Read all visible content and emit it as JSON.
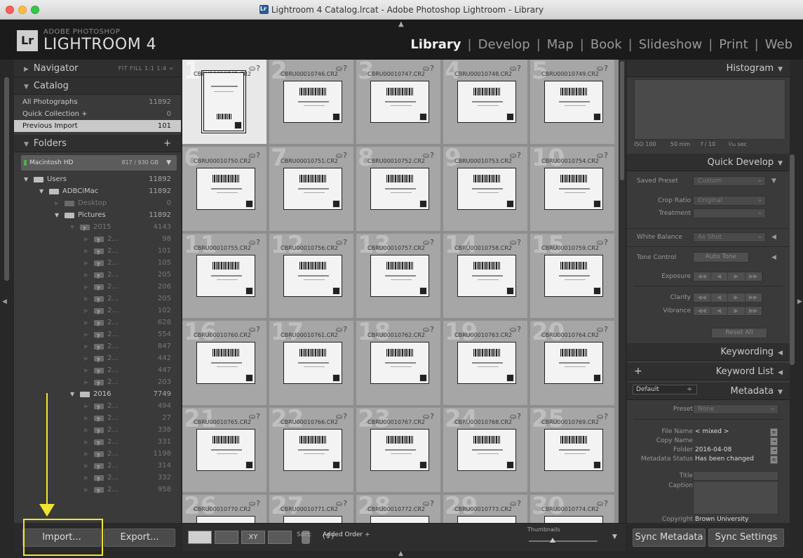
{
  "window": {
    "title": "Lightroom 4 Catalog.lrcat - Adobe Photoshop Lightroom - Library"
  },
  "brand": {
    "logo": "Lr",
    "line1": "ADOBE PHOTOSHOP",
    "line2": "LIGHTROOM 4"
  },
  "modules": [
    "Library",
    "Develop",
    "Map",
    "Book",
    "Slideshow",
    "Print",
    "Web"
  ],
  "navigator": {
    "title": "Navigator",
    "options": "FIT  FILL  1:1  1:4 ÷"
  },
  "catalog": {
    "title": "Catalog",
    "items": [
      {
        "label": "All Photographs",
        "count": "11892"
      },
      {
        "label": "Quick Collection +",
        "count": "0"
      },
      {
        "label": "Previous Import",
        "count": "101"
      }
    ]
  },
  "folders": {
    "title": "Folders",
    "plus": "+",
    "volume": {
      "name": "Macintosh HD",
      "capacity": "817 / 930 GB",
      "menu": "▼"
    },
    "tree": [
      {
        "label": "Users",
        "count": "11892",
        "indent": 0,
        "open": true,
        "type": "folder",
        "dim": false
      },
      {
        "label": "ADBCiMac",
        "count": "11892",
        "indent": 1,
        "open": true,
        "type": "folder",
        "dim": false
      },
      {
        "label": "Desktop",
        "count": "0",
        "indent": 2,
        "open": false,
        "type": "folder",
        "dim": true
      },
      {
        "label": "Pictures",
        "count": "11892",
        "indent": 2,
        "open": true,
        "type": "folder",
        "dim": false
      },
      {
        "label": "2015",
        "count": "4143",
        "indent": 3,
        "open": true,
        "type": "q",
        "dim": true
      },
      {
        "label": "2...",
        "count": "98",
        "indent": 4,
        "open": false,
        "type": "q",
        "dim": true
      },
      {
        "label": "2...",
        "count": "101",
        "indent": 4,
        "open": false,
        "type": "q",
        "dim": true
      },
      {
        "label": "2...",
        "count": "105",
        "indent": 4,
        "open": false,
        "type": "q",
        "dim": true
      },
      {
        "label": "2...",
        "count": "205",
        "indent": 4,
        "open": false,
        "type": "q",
        "dim": true
      },
      {
        "label": "2...",
        "count": "206",
        "indent": 4,
        "open": false,
        "type": "q",
        "dim": true
      },
      {
        "label": "2...",
        "count": "205",
        "indent": 4,
        "open": false,
        "type": "q",
        "dim": true
      },
      {
        "label": "2...",
        "count": "102",
        "indent": 4,
        "open": false,
        "type": "q",
        "dim": true
      },
      {
        "label": "2...",
        "count": "628",
        "indent": 4,
        "open": false,
        "type": "q",
        "dim": true
      },
      {
        "label": "2...",
        "count": "554",
        "indent": 4,
        "open": false,
        "type": "q",
        "dim": true
      },
      {
        "label": "2...",
        "count": "847",
        "indent": 4,
        "open": false,
        "type": "q",
        "dim": true
      },
      {
        "label": "2...",
        "count": "442",
        "indent": 4,
        "open": false,
        "type": "q",
        "dim": true
      },
      {
        "label": "2...",
        "count": "447",
        "indent": 4,
        "open": false,
        "type": "q",
        "dim": true
      },
      {
        "label": "2...",
        "count": "203",
        "indent": 4,
        "open": false,
        "type": "q",
        "dim": true
      },
      {
        "label": "2016",
        "count": "7749",
        "indent": 3,
        "open": true,
        "type": "folder",
        "dim": false
      },
      {
        "label": "2...",
        "count": "494",
        "indent": 4,
        "open": false,
        "type": "q",
        "dim": true
      },
      {
        "label": "2...",
        "count": "27",
        "indent": 4,
        "open": false,
        "type": "q",
        "dim": true
      },
      {
        "label": "2...",
        "count": "338",
        "indent": 4,
        "open": false,
        "type": "q",
        "dim": true
      },
      {
        "label": "2...",
        "count": "331",
        "indent": 4,
        "open": false,
        "type": "q",
        "dim": true
      },
      {
        "label": "2...",
        "count": "1198",
        "indent": 4,
        "open": false,
        "type": "q",
        "dim": true
      },
      {
        "label": "2...",
        "count": "314",
        "indent": 4,
        "open": false,
        "type": "q",
        "dim": true
      },
      {
        "label": "2...",
        "count": "332",
        "indent": 4,
        "open": false,
        "type": "q",
        "dim": true
      },
      {
        "label": "2...",
        "count": "958",
        "indent": 4,
        "open": false,
        "type": "q",
        "dim": true
      }
    ]
  },
  "left_buttons": {
    "import": "Import...",
    "export": "Export..."
  },
  "grid": {
    "cells": [
      {
        "num": "1",
        "file": "CBRU00010745.CR2"
      },
      {
        "num": "2",
        "file": "CBRU00010746.CR2"
      },
      {
        "num": "3",
        "file": "CBRU00010747.CR2"
      },
      {
        "num": "4",
        "file": "CBRU00010748.CR2"
      },
      {
        "num": "5",
        "file": "CBRU00010749.CR2"
      },
      {
        "num": "6",
        "file": "CBRU00010750.CR2"
      },
      {
        "num": "7",
        "file": "CBRU00010751.CR2"
      },
      {
        "num": "8",
        "file": "CBRU00010752.CR2"
      },
      {
        "num": "9",
        "file": "CBRU00010753.CR2"
      },
      {
        "num": "10",
        "file": "CBRU00010754.CR2"
      },
      {
        "num": "11",
        "file": "CBRU00010755.CR2"
      },
      {
        "num": "12",
        "file": "CBRU00010756.CR2"
      },
      {
        "num": "13",
        "file": "CBRU00010757.CR2"
      },
      {
        "num": "14",
        "file": "CBRU00010758.CR2"
      },
      {
        "num": "15",
        "file": "CBRU00010759.CR2"
      },
      {
        "num": "16",
        "file": "CBRU00010760.CR2"
      },
      {
        "num": "17",
        "file": "CBRU00010761.CR2"
      },
      {
        "num": "18",
        "file": "CBRU00010762.CR2"
      },
      {
        "num": "19",
        "file": "CBRU00010763.CR2"
      },
      {
        "num": "20",
        "file": "CBRU00010764.CR2"
      },
      {
        "num": "21",
        "file": "CBRU00010765.CR2"
      },
      {
        "num": "22",
        "file": "CBRU00010766.CR2"
      },
      {
        "num": "23",
        "file": "CBRU00010767.CR2"
      },
      {
        "num": "24",
        "file": "CBRU00010768.CR2"
      },
      {
        "num": "25",
        "file": "CBRU00010769.CR2"
      },
      {
        "num": "26",
        "file": "CBRU00010770.CR2"
      },
      {
        "num": "27",
        "file": "CBRU00010771.CR2"
      },
      {
        "num": "28",
        "file": "CBRU00010772.CR2"
      },
      {
        "num": "29",
        "file": "CBRU00010773.CR2"
      },
      {
        "num": "30",
        "file": "CBRU00010774.CR2"
      }
    ],
    "selected_index": 0,
    "cell_icons": "⛀?"
  },
  "toolbar": {
    "sort_label": "Sort:",
    "sort_value": "Added Order ÷",
    "thumbnails_label": "Thumbnails",
    "thumbnail_size": 0.35
  },
  "histogram": {
    "title": "Histogram",
    "iso": "ISO 100",
    "focal": "50 mm",
    "aperture": "f / 10",
    "shutter": "¹⁄₁₀ sec"
  },
  "quick_develop": {
    "title": "Quick Develop",
    "saved_preset_label": "Saved Preset",
    "saved_preset_value": "Custom",
    "crop_label": "Crop Ratio",
    "crop_value": "Original",
    "treatment_label": "Treatment",
    "white_balance_label": "White Balance",
    "white_balance_value": "As Shot",
    "tone_control_label": "Tone Control",
    "auto_tone": "Auto Tone",
    "exposure_label": "Exposure",
    "clarity_label": "Clarity",
    "vibrance_label": "Vibrance",
    "reset_all": "Reset All"
  },
  "keywording": {
    "title": "Keywording"
  },
  "keyword_list": {
    "title": "Keyword List",
    "plus": "+"
  },
  "metadata": {
    "title": "Metadata",
    "view": "Default",
    "preset_label": "Preset",
    "preset_value": "None",
    "fields": [
      {
        "label": "File Name",
        "value": "< mixed >"
      },
      {
        "label": "Copy Name",
        "value": ""
      },
      {
        "label": "Folder",
        "value": "2016-04-08"
      },
      {
        "label": "Metadata Status",
        "value": "Has been changed"
      },
      {
        "label": "Title",
        "value": ""
      },
      {
        "label": "Caption",
        "value": ""
      },
      {
        "label": "Copyright",
        "value": "Brown University"
      }
    ]
  },
  "right_buttons": {
    "sync_metadata": "Sync Metadata",
    "sync_settings": "Sync Settings"
  }
}
